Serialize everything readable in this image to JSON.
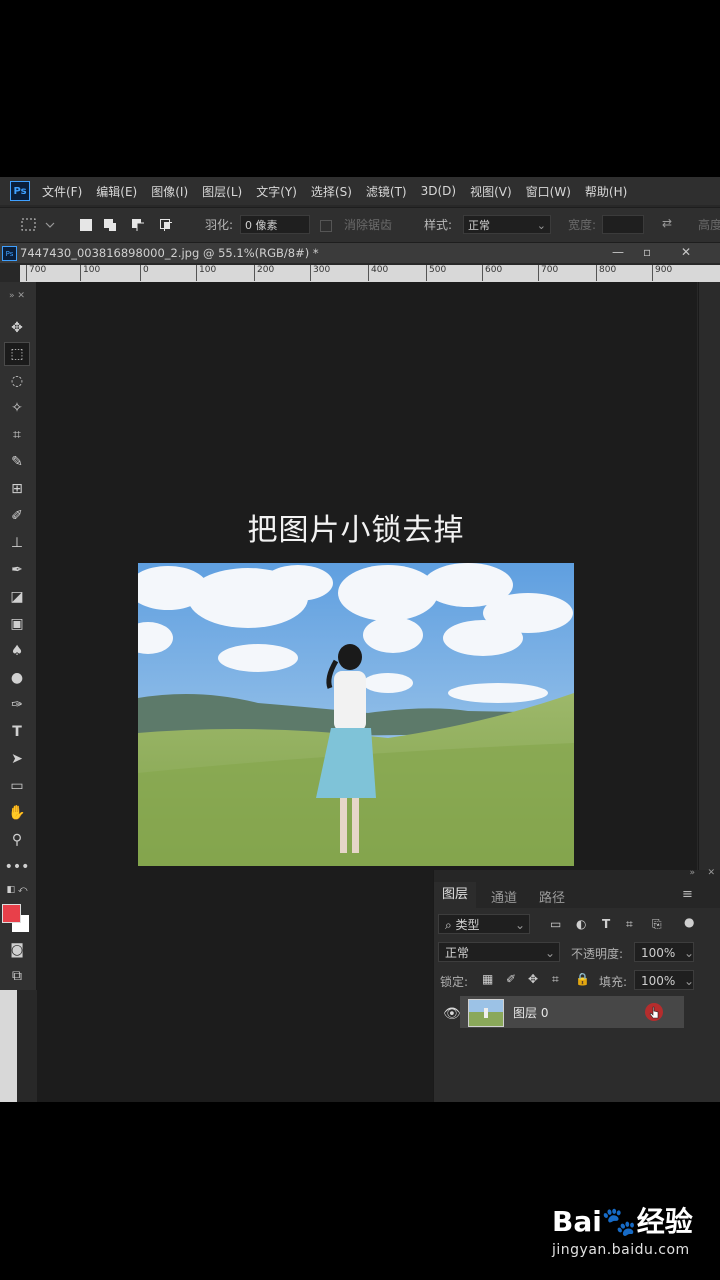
{
  "app": {
    "logo": "Ps",
    "menu": [
      "文件(F)",
      "编辑(E)",
      "图像(I)",
      "图层(L)",
      "文字(Y)",
      "选择(S)",
      "滤镜(T)",
      "3D(D)",
      "视图(V)",
      "窗口(W)",
      "帮助(H)"
    ]
  },
  "options": {
    "feather_label": "羽化:",
    "feather_value": "0 像素",
    "antialias_label": "消除锯齿",
    "style_label": "样式:",
    "style_value": "正常",
    "width_label": "宽度:",
    "height_label": "高度"
  },
  "document": {
    "tab_title": "7447430_003816898000_2.jpg @ 55.1%(RGB/8#) *",
    "ruler_ticks": [
      "700",
      "100",
      "0",
      "100",
      "200",
      "300",
      "400",
      "500",
      "600",
      "700",
      "800",
      "900"
    ]
  },
  "canvas": {
    "overlay_text": "把图片小锁去掉"
  },
  "layers_panel": {
    "tabs": [
      "图层",
      "通道",
      "路径"
    ],
    "filter_value": "类型",
    "blend_mode": "正常",
    "opacity_label": "不透明度:",
    "opacity_value": "100%",
    "lock_label": "锁定:",
    "fill_label": "填充:",
    "fill_value": "100%",
    "layer_name": "图层 0"
  },
  "watermark": {
    "brand": "Bai",
    "brand2": "经验",
    "url": "jingyan.baidu.com"
  },
  "colors": {
    "foreground": "#e8404a",
    "background": "#ffffff",
    "accent": "#3fa0ff"
  }
}
